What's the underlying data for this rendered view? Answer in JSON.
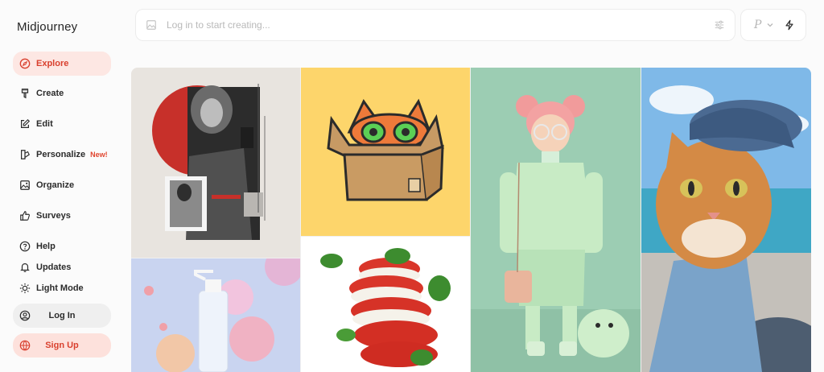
{
  "sidebar": {
    "brand": "Midjourney",
    "items": [
      {
        "label": "Explore",
        "icon": "compass-icon"
      },
      {
        "label": "Create",
        "icon": "brush-icon"
      },
      {
        "label": "Edit",
        "icon": "edit-icon"
      },
      {
        "label": "Personalize",
        "icon": "palette-icon",
        "badge": "New!"
      },
      {
        "label": "Organize",
        "icon": "image-icon"
      },
      {
        "label": "Surveys",
        "icon": "thumbs-up-icon"
      }
    ],
    "secondary": [
      {
        "label": "Help",
        "icon": "help-icon"
      },
      {
        "label": "Updates",
        "icon": "bell-icon"
      },
      {
        "label": "Light Mode",
        "icon": "sun-icon"
      }
    ],
    "login_label": "Log In",
    "signup_label": "Sign Up"
  },
  "search": {
    "placeholder": "Log in to start creating..."
  },
  "toolbar": {
    "profile_letter": "P"
  },
  "gallery": {
    "images": [
      {
        "subject": "collage-woman"
      },
      {
        "subject": "cat-in-box"
      },
      {
        "subject": "girl-in-mint-outfit"
      },
      {
        "subject": "cat-with-cap"
      },
      {
        "subject": "skincare-bottle-flowers"
      },
      {
        "subject": "tomato-mozzarella-stack"
      }
    ]
  },
  "colors": {
    "accent": "#d9402e",
    "accent_bg": "#fde7e3"
  }
}
